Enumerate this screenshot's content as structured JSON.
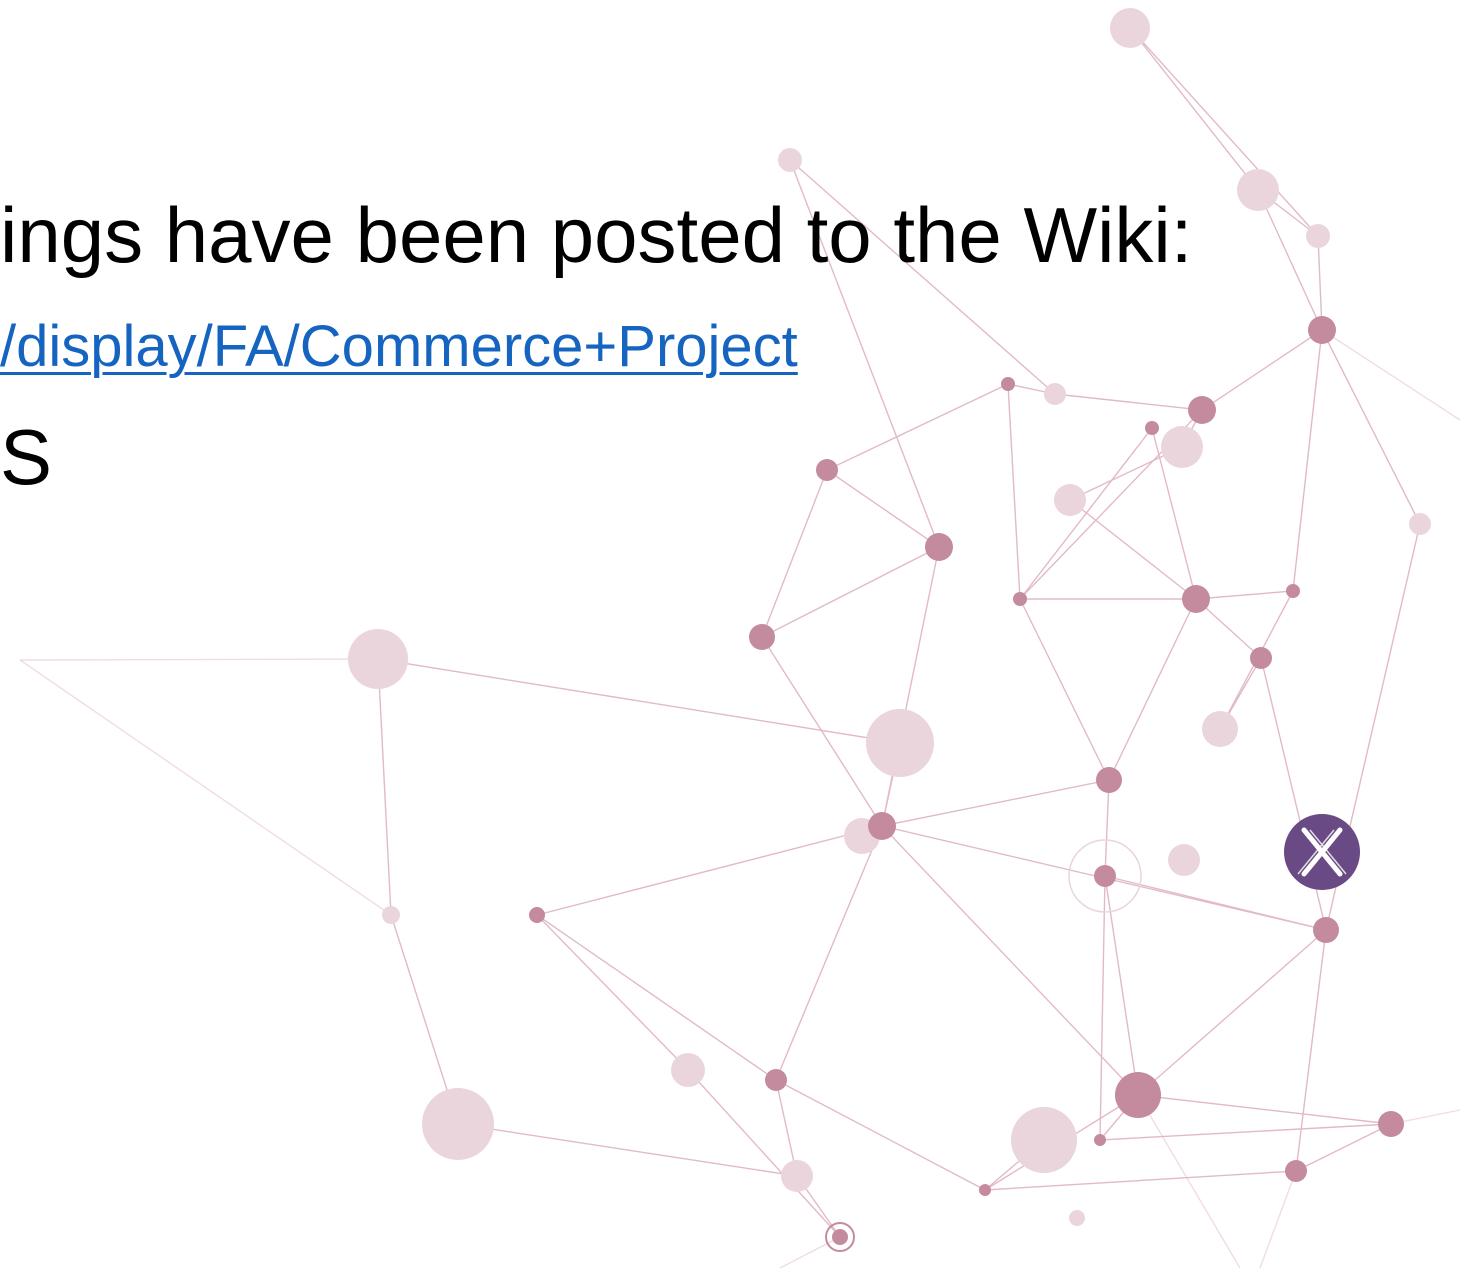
{
  "content": {
    "line1": "ings have been posted to the Wiki:",
    "link": "/display/FA/Commerce+Project",
    "line3": "S"
  },
  "colors": {
    "text": "#000000",
    "link": "#1565c0",
    "node_dark": "#c48a9e",
    "node_light": "#ebd5dc",
    "edge": "#d9a3b4",
    "logo_bg": "#6a4a84"
  },
  "icons": {
    "background": "network-graph-icon",
    "logo": "x-logo-icon"
  }
}
